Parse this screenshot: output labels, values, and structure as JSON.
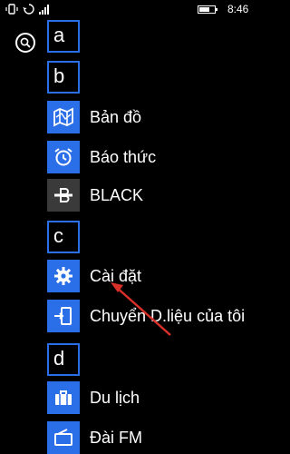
{
  "status_bar": {
    "time": "8:46",
    "battery_level": 0.7,
    "icons": [
      "vibrate-icon",
      "sync-icon",
      "signal-icon",
      "battery-icon"
    ]
  },
  "search": {
    "icon": "search-icon"
  },
  "sections": [
    {
      "letter": "a"
    },
    {
      "letter": "b",
      "apps": [
        {
          "label": "Bản đồ",
          "icon": "map-icon",
          "color": "#2a6ee8"
        },
        {
          "label": "Báo thức",
          "icon": "alarm-clock-icon",
          "color": "#2a6ee8"
        },
        {
          "label": "BLACK",
          "icon": "black-bluetooth-icon",
          "color": "#3a3a3a"
        }
      ]
    },
    {
      "letter": "c",
      "apps": [
        {
          "label": "Cài đặt",
          "icon": "gear-icon",
          "color": "#2a6ee8"
        },
        {
          "label": "Chuyển D.liệu của tôi",
          "icon": "transfer-phone-icon",
          "color": "#2a6ee8"
        }
      ]
    },
    {
      "letter": "d",
      "apps": [
        {
          "label": "Du lịch",
          "icon": "suitcase-icon",
          "color": "#2a6ee8"
        },
        {
          "label": "Đài FM",
          "icon": "radio-icon",
          "color": "#2a6ee8"
        }
      ]
    }
  ],
  "annotation": {
    "color": "#d9302a",
    "points_to": "Cài đặt"
  }
}
